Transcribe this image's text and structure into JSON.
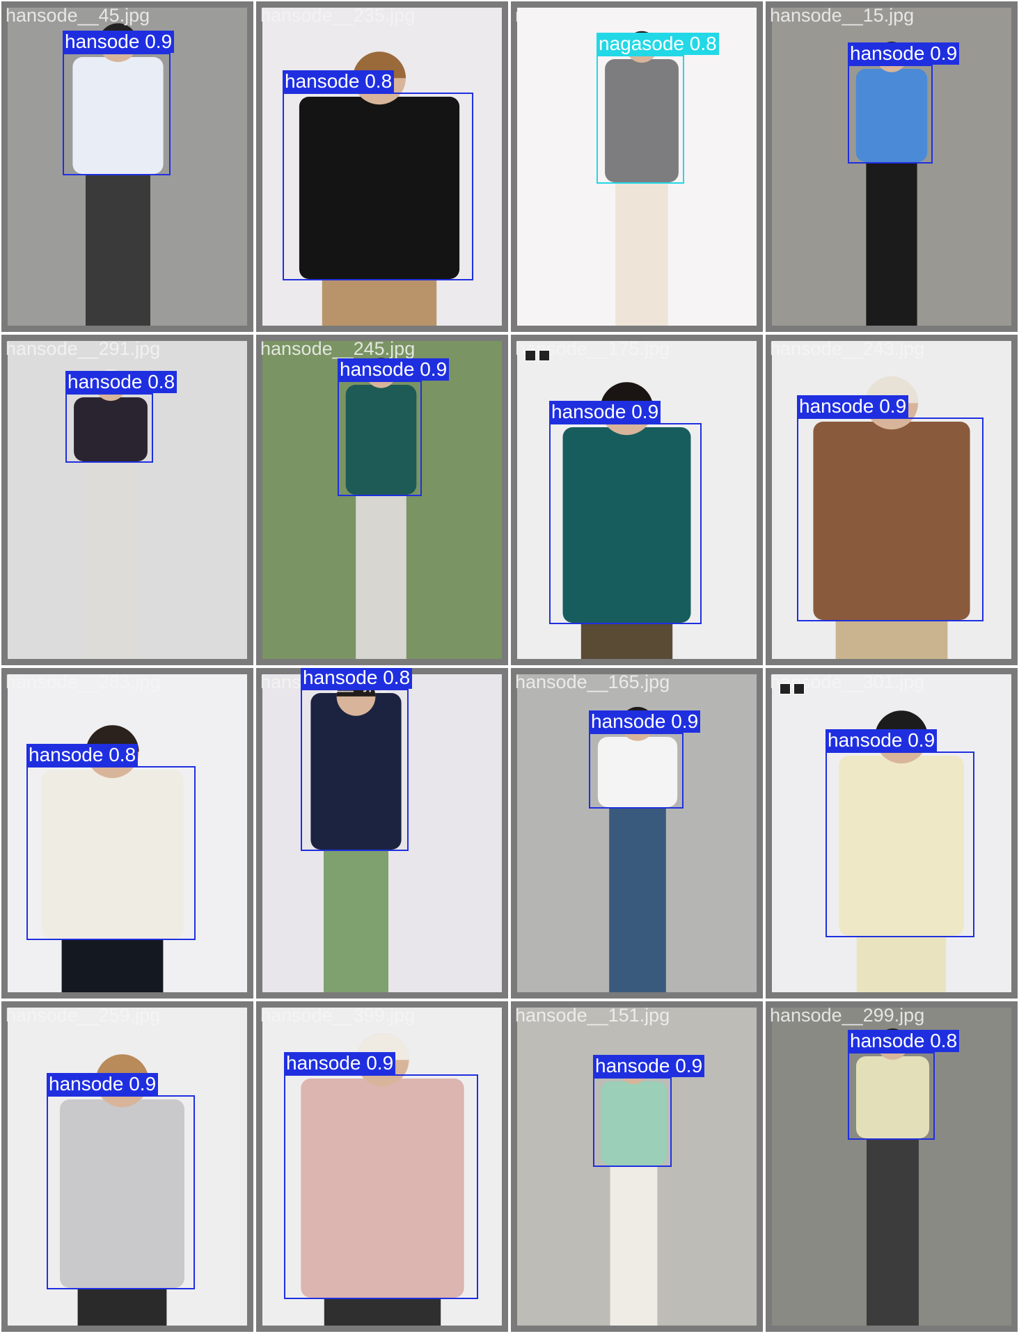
{
  "colors": {
    "tile_border": "#7a7a7a",
    "hansode": "#1f2fe0",
    "nagasode": "#22d8e6",
    "label_text_nagasode": "#ffffff"
  },
  "tiles": [
    {
      "file": "hansode__45.jpg",
      "bg": "#9c9c9a",
      "detections": [
        {
          "label": "hansode 0.9",
          "cls": "hansode"
        }
      ],
      "icons": false
    },
    {
      "file": "hansode__235.jpg",
      "bg": "#eceaec",
      "detections": [
        {
          "label": "hansode 0.8",
          "cls": "hansode"
        }
      ],
      "icons": false
    },
    {
      "file": "nagasode__63.jpg",
      "bg": "#f7f4f5",
      "detections": [
        {
          "label": "nagasode 0.8",
          "cls": "nagasode"
        }
      ],
      "icons": false
    },
    {
      "file": "hansode__15.jpg",
      "bg": "#9a9893",
      "detections": [
        {
          "label": "hansode 0.9",
          "cls": "hansode"
        }
      ],
      "icons": false
    },
    {
      "file": "hansode__291.jpg",
      "bg": "#dcdcdc",
      "detections": [
        {
          "label": "hansode 0.8",
          "cls": "hansode"
        }
      ],
      "icons": false
    },
    {
      "file": "hansode__245.jpg",
      "bg": "#7a9463",
      "detections": [
        {
          "label": "hansode 0.9",
          "cls": "hansode"
        }
      ],
      "icons": false
    },
    {
      "file": "hansode__175.jpg",
      "bg": "#eeeeef",
      "detections": [
        {
          "label": "hansode 0.9",
          "cls": "hansode"
        }
      ],
      "icons": true
    },
    {
      "file": "hansode__243.jpg",
      "bg": "#ededee",
      "detections": [
        {
          "label": "hansode 0.9",
          "cls": "hansode"
        }
      ],
      "icons": false
    },
    {
      "file": "hansode__283.jpg",
      "bg": "#f0f0f2",
      "detections": [
        {
          "label": "hansode 0.8",
          "cls": "hansode"
        }
      ],
      "icons": false
    },
    {
      "file": "hansode__ .jpg",
      "bg": "#e8e6ea",
      "detections": [
        {
          "label": "hansode 0.8",
          "cls": "hansode"
        }
      ],
      "icons": false
    },
    {
      "file": "hansode__165.jpg",
      "bg": "#b5b6b4",
      "detections": [
        {
          "label": "hansode 0.9",
          "cls": "hansode"
        }
      ],
      "icons": false
    },
    {
      "file": "hansode__301.jpg",
      "bg": "#eeeef1",
      "detections": [
        {
          "label": "hansode 0.9",
          "cls": "hansode"
        }
      ],
      "icons": true
    },
    {
      "file": "hansode__259.jpg",
      "bg": "#eeeeef",
      "detections": [
        {
          "label": "hansode 0.9",
          "cls": "hansode"
        }
      ],
      "icons": false
    },
    {
      "file": "hansode__399.jpg",
      "bg": "#eeeeef",
      "detections": [
        {
          "label": "hansode 0.9",
          "cls": "hansode"
        }
      ],
      "icons": false
    },
    {
      "file": "hansode__151.jpg",
      "bg": "#bdbcb6",
      "detections": [
        {
          "label": "hansode 0.9",
          "cls": "hansode"
        }
      ],
      "icons": false
    },
    {
      "file": "hansode__299.jpg",
      "bg": "#8a8a84",
      "detections": [
        {
          "label": "hansode 0.8",
          "cls": "hansode"
        }
      ],
      "icons": false
    }
  ]
}
